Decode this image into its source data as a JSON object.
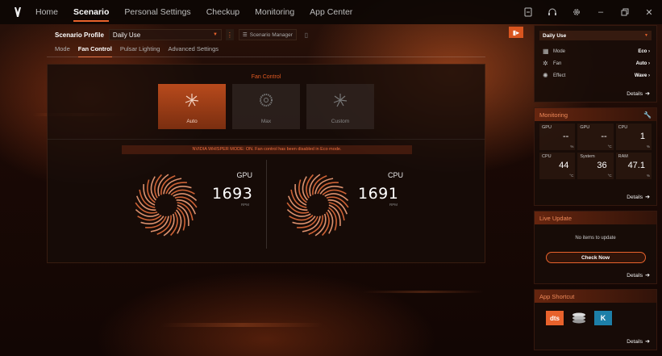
{
  "nav": {
    "tabs": [
      {
        "label": "Home"
      },
      {
        "label": "Scenario"
      },
      {
        "label": "Personal Settings"
      },
      {
        "label": "Checkup"
      },
      {
        "label": "Monitoring"
      },
      {
        "label": "App Center"
      }
    ],
    "active_index": 1
  },
  "scenario": {
    "profile_label": "Scenario Profile",
    "profile_value": "Daily Use",
    "manager_label": "Scenario Manager"
  },
  "subtabs": [
    "Mode",
    "Fan Control",
    "Pulsar Lighting",
    "Advanced Settings"
  ],
  "fan_control": {
    "title": "Fan Control",
    "modes": [
      {
        "label": "Auto",
        "active": true
      },
      {
        "label": "Max",
        "active": false
      },
      {
        "label": "Custom",
        "active": false
      }
    ],
    "notice": "NVIDIA WHISPER MODE: ON. Fan control has been disabled in Eco mode.",
    "gpu": {
      "label": "GPU",
      "rpm": "1693",
      "unit": "RPM"
    },
    "cpu": {
      "label": "CPU",
      "rpm": "1691",
      "unit": "RPM"
    }
  },
  "profile_card": {
    "selected": "Daily Use",
    "rows": [
      {
        "key": "Mode",
        "value": "Eco"
      },
      {
        "key": "Fan",
        "value": "Auto"
      },
      {
        "key": "Effect",
        "value": "Wave"
      }
    ],
    "details": "Details"
  },
  "monitoring": {
    "title": "Monitoring",
    "cells": [
      {
        "label": "GPU",
        "value": "--",
        "unit": "%"
      },
      {
        "label": "GPU",
        "value": "--",
        "unit": "°C"
      },
      {
        "label": "CPU",
        "value": "1",
        "unit": "%"
      },
      {
        "label": "CPU",
        "value": "44",
        "unit": "°C"
      },
      {
        "label": "System",
        "value": "36",
        "unit": "°C"
      },
      {
        "label": "RAM",
        "value": "47.1",
        "unit": "%"
      }
    ],
    "details": "Details"
  },
  "live_update": {
    "title": "Live Update",
    "empty_text": "No items to update",
    "button": "Check Now",
    "details": "Details"
  },
  "app_shortcut": {
    "title": "App Shortcut",
    "apps": [
      "dts",
      "K"
    ],
    "details": "Details"
  },
  "colors": {
    "accent": "#e8622c",
    "accent_dark": "#b84a1c"
  }
}
